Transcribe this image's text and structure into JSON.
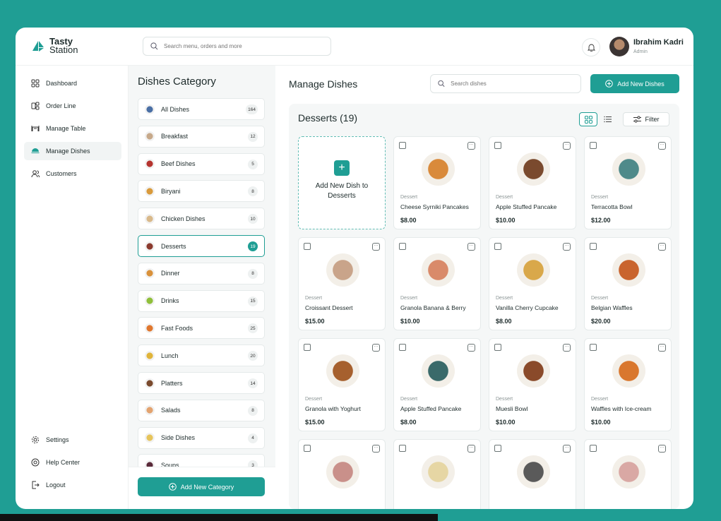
{
  "brand": {
    "line1": "Tasty",
    "line2": "Station",
    "accent": "#1f9e94"
  },
  "search": {
    "placeholder": "Search menu, orders and more"
  },
  "user": {
    "name": "Ibrahim Kadri",
    "role": "Admin"
  },
  "sidebar": {
    "items": [
      {
        "label": "Dashboard",
        "icon": "grid-icon"
      },
      {
        "label": "Order Line",
        "icon": "order-icon"
      },
      {
        "label": "Manage Table",
        "icon": "table-icon"
      },
      {
        "label": "Manage Dishes",
        "icon": "dish-icon",
        "active": true
      },
      {
        "label": "Customers",
        "icon": "users-icon"
      }
    ],
    "bottom": [
      {
        "label": "Settings",
        "icon": "gear-icon"
      },
      {
        "label": "Help Center",
        "icon": "help-icon"
      },
      {
        "label": "Logout",
        "icon": "logout-icon"
      }
    ]
  },
  "categories": {
    "title": "Dishes Category",
    "items": [
      {
        "label": "All Dishes",
        "count": "164",
        "color": "#4a6fa5"
      },
      {
        "label": "Breakfast",
        "count": "12",
        "color": "#c7a98a"
      },
      {
        "label": "Beef Dishes",
        "count": "5",
        "color": "#b5342f"
      },
      {
        "label": "Biryani",
        "count": "8",
        "color": "#d99a3b"
      },
      {
        "label": "Chicken Dishes",
        "count": "10",
        "color": "#d9b98a"
      },
      {
        "label": "Desserts",
        "count": "19",
        "color": "#8b3a2e",
        "active": true
      },
      {
        "label": "Dinner",
        "count": "8",
        "color": "#d9913b"
      },
      {
        "label": "Drinks",
        "count": "15",
        "color": "#8fbf3a"
      },
      {
        "label": "Fast Foods",
        "count": "25",
        "color": "#e0772e"
      },
      {
        "label": "Lunch",
        "count": "20",
        "color": "#e0b43a"
      },
      {
        "label": "Platters",
        "count": "14",
        "color": "#7a4a2e"
      },
      {
        "label": "Salads",
        "count": "8",
        "color": "#e3a36f"
      },
      {
        "label": "Side Dishes",
        "count": "4",
        "color": "#e6c45a"
      },
      {
        "label": "Soups",
        "count": "3",
        "color": "#5a2a3a"
      }
    ],
    "add_label": "Add New Category"
  },
  "main": {
    "title": "Manage Dishes",
    "search_placeholder": "Search dishes",
    "add_label": "Add New Dishes",
    "section_title": "Desserts (19)",
    "filter_label": "Filter",
    "add_card_label": "Add New Dish to Desserts",
    "dishes": [
      {
        "category": "Dessert",
        "name": "Cheese Syrniki Pancakes",
        "price": "$8.00",
        "color": "#d98a3b"
      },
      {
        "category": "Dessert",
        "name": "Apple Stuffed Pancake",
        "price": "$10.00",
        "color": "#7a4a2e"
      },
      {
        "category": "Dessert",
        "name": "Terracotta Bowl",
        "price": "$12.00",
        "color": "#4f8a8a"
      },
      {
        "category": "Dessert",
        "name": "Croissant Dessert",
        "price": "$15.00",
        "color": "#c9a48a"
      },
      {
        "category": "Dessert",
        "name": "Granola Banana & Berry",
        "price": "$10.00",
        "color": "#d98a6a"
      },
      {
        "category": "Dessert",
        "name": "Vanilla Cherry Cupcake",
        "price": "$8.00",
        "color": "#d9a84a"
      },
      {
        "category": "Dessert",
        "name": "Belgian Waffles",
        "price": "$20.00",
        "color": "#c9642e"
      },
      {
        "category": "Dessert",
        "name": "Granola with Yoghurt",
        "price": "$15.00",
        "color": "#a6602e"
      },
      {
        "category": "Dessert",
        "name": "Apple Stuffed Pancake",
        "price": "$8.00",
        "color": "#3a6a6a"
      },
      {
        "category": "Dessert",
        "name": "Muesli Bowl",
        "price": "$10.00",
        "color": "#8a4a2a"
      },
      {
        "category": "Dessert",
        "name": "Waffles with Ice-cream",
        "price": "$10.00",
        "color": "#d9772e"
      },
      {
        "category": "",
        "name": "",
        "price": "",
        "color": "#c9908a"
      },
      {
        "category": "",
        "name": "",
        "price": "",
        "color": "#e6d6a4"
      },
      {
        "category": "",
        "name": "",
        "price": "",
        "color": "#5a5a5a"
      },
      {
        "category": "",
        "name": "",
        "price": "",
        "color": "#d9a8a4"
      }
    ]
  }
}
